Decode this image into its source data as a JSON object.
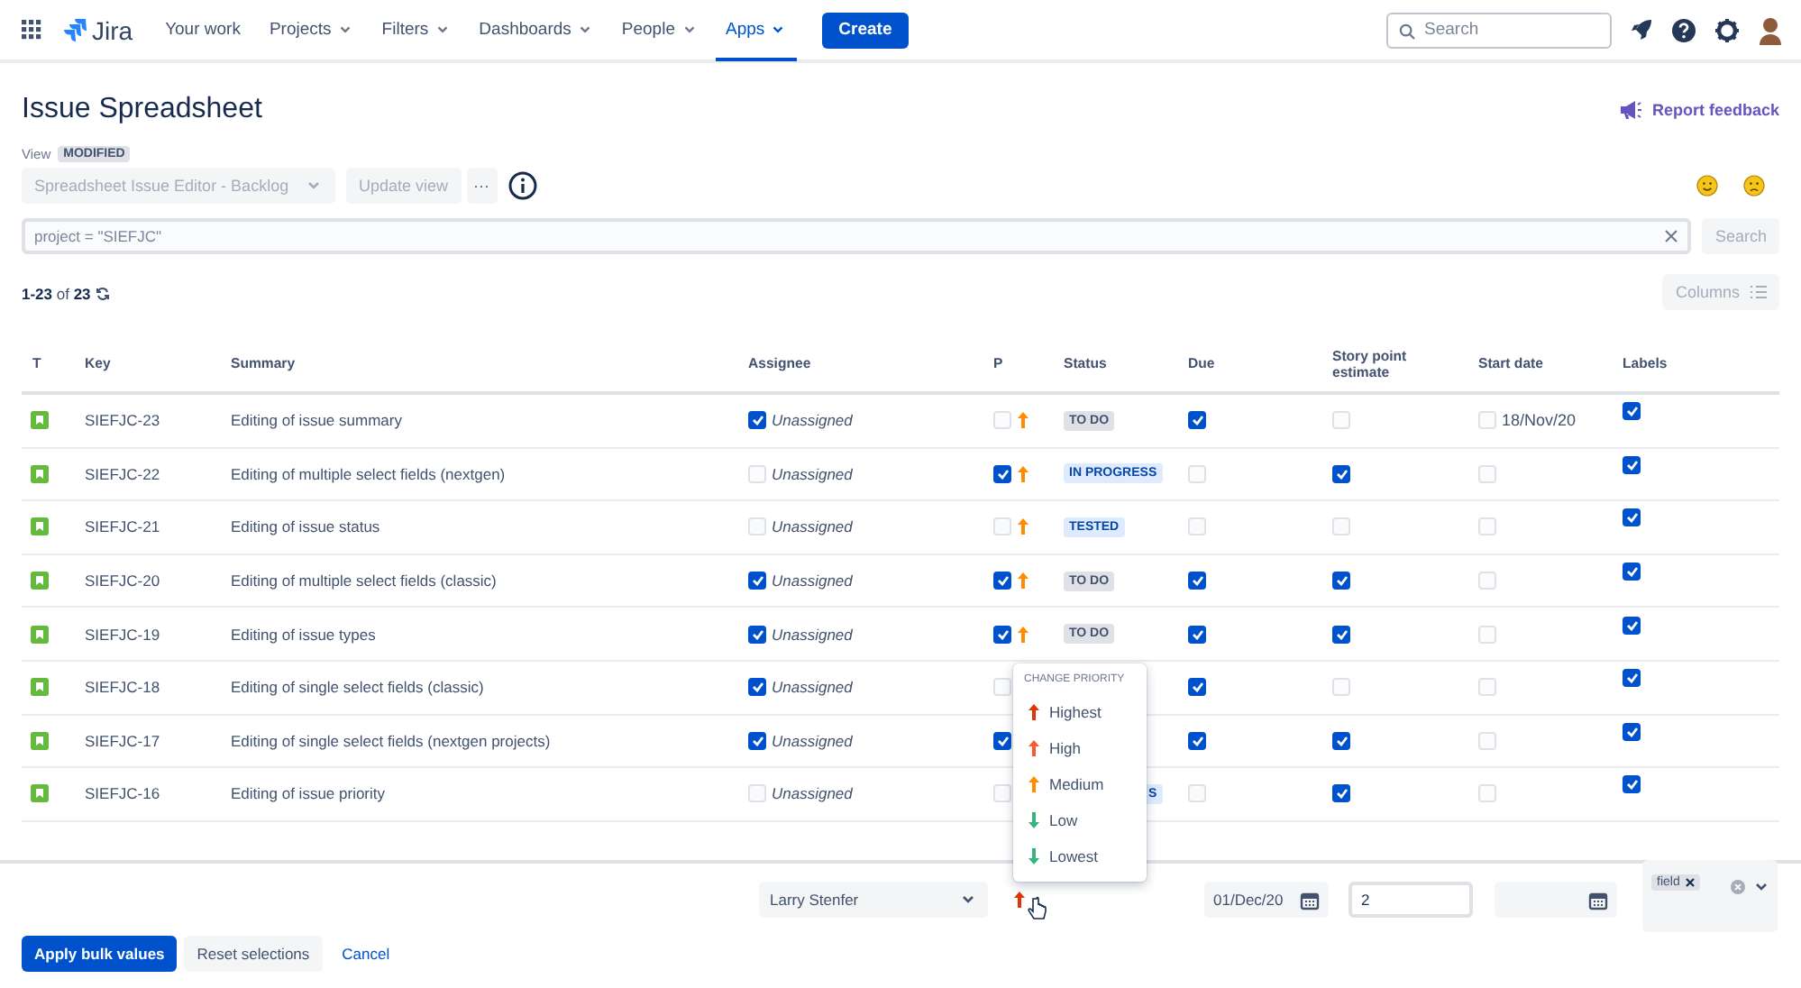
{
  "topbar": {
    "product": "Jira",
    "nav": [
      {
        "label": "Your work",
        "dropdown": false,
        "selected": false
      },
      {
        "label": "Projects",
        "dropdown": true,
        "selected": false
      },
      {
        "label": "Filters",
        "dropdown": true,
        "selected": false
      },
      {
        "label": "Dashboards",
        "dropdown": true,
        "selected": false
      },
      {
        "label": "People",
        "dropdown": true,
        "selected": false
      },
      {
        "label": "Apps",
        "dropdown": true,
        "selected": true
      }
    ],
    "create": "Create",
    "search": {
      "placeholder": "Search"
    }
  },
  "page": {
    "title": "Issue Spreadsheet",
    "feedback": "Report feedback",
    "view": {
      "label": "View",
      "badge": "MODIFIED",
      "select": "Spreadsheet Issue Editor - Backlog",
      "update": "Update view",
      "more": "···"
    },
    "query": {
      "placeholder": "project = \"SIEFJC\"",
      "search": "Search"
    },
    "counter": "**1-23** of **23**",
    "columns": "Columns"
  },
  "table": {
    "columns": [
      "T",
      "Key",
      "Summary",
      "Assignee",
      "P",
      "Status",
      "Due",
      "Story point estimate",
      "Start date",
      "Labels"
    ],
    "rows": [
      {
        "key": "SIEFJC-23",
        "summary": "Editing of issue summary",
        "assignee": "Unassigned",
        "assignee_checked": true,
        "p_checked": false,
        "priority": {
          "kind": "medium"
        },
        "status": {
          "text": "TO DO",
          "kind": "todo",
          "partial": false
        },
        "due_checked": true,
        "sp_checked": false,
        "start_checked": false,
        "start_date": "18/Nov/20",
        "labels_checked": true
      },
      {
        "key": "SIEFJC-22",
        "summary": "Editing of multiple select fields (nextgen)",
        "assignee": "Unassigned",
        "assignee_checked": false,
        "p_checked": true,
        "priority": {
          "kind": "medium"
        },
        "status": {
          "text": "IN PROGRESS",
          "kind": "inprogress",
          "partial": false
        },
        "due_checked": false,
        "sp_checked": true,
        "start_checked": false,
        "labels_checked": true
      },
      {
        "key": "SIEFJC-21",
        "summary": "Editing of issue status",
        "assignee": "Unassigned",
        "assignee_checked": false,
        "p_checked": false,
        "priority": {
          "kind": "medium"
        },
        "status": {
          "text": "TESTED",
          "kind": "tested",
          "partial": false
        },
        "due_checked": false,
        "sp_checked": false,
        "start_checked": false,
        "labels_checked": true
      },
      {
        "key": "SIEFJC-20",
        "summary": "Editing of multiple select fields (classic)",
        "assignee": "Unassigned",
        "assignee_checked": true,
        "p_checked": true,
        "priority": {
          "kind": "medium"
        },
        "status": {
          "text": "TO DO",
          "kind": "todo",
          "partial": false
        },
        "due_checked": true,
        "sp_checked": true,
        "start_checked": false,
        "labels_checked": true
      },
      {
        "key": "SIEFJC-19",
        "summary": "Editing of issue types",
        "assignee": "Unassigned",
        "assignee_checked": true,
        "p_checked": true,
        "priority": {
          "kind": "medium"
        },
        "status": {
          "text": "TO DO",
          "kind": "todo",
          "partial": false
        },
        "due_checked": true,
        "sp_checked": true,
        "start_checked": false,
        "labels_checked": true
      },
      {
        "key": "SIEFJC-18",
        "summary": "Editing of single select fields (classic)",
        "assignee": "Unassigned",
        "assignee_checked": true,
        "p_checked": false,
        "due_checked": true,
        "sp_checked": false,
        "start_checked": false,
        "labels_checked": true
      },
      {
        "key": "SIEFJC-17",
        "summary": "Editing of single select fields (nextgen projects)",
        "assignee": "Unassigned",
        "assignee_checked": true,
        "p_checked": true,
        "due_checked": true,
        "sp_checked": true,
        "start_checked": false,
        "labels_checked": true
      },
      {
        "key": "SIEFJC-16",
        "summary": "Editing of issue priority",
        "assignee": "Unassigned",
        "assignee_checked": false,
        "p_checked": false,
        "status": {
          "text": "S",
          "kind": "inprogress",
          "partial": true
        },
        "due_checked": false,
        "sp_checked": true,
        "start_checked": false,
        "labels_checked": true
      }
    ]
  },
  "priority_menu": {
    "title": "CHANGE PRIORITY",
    "items": [
      {
        "label": "Highest",
        "kind": "highest"
      },
      {
        "label": "High",
        "kind": "high"
      },
      {
        "label": "Medium",
        "kind": "medium"
      },
      {
        "label": "Low",
        "kind": "low"
      },
      {
        "label": "Lowest",
        "kind": "lowest"
      }
    ]
  },
  "bulk": {
    "assignee": "Larry Stenfer",
    "priority": {
      "kind": "highest"
    },
    "due": "01/Dec/20",
    "story_points": "2",
    "label_tag": "field",
    "buttons": [
      {
        "label": "Apply bulk values",
        "kind": "primary"
      },
      {
        "label": "Reset selections",
        "kind": "default"
      },
      {
        "label": "Cancel",
        "kind": "link"
      }
    ]
  }
}
